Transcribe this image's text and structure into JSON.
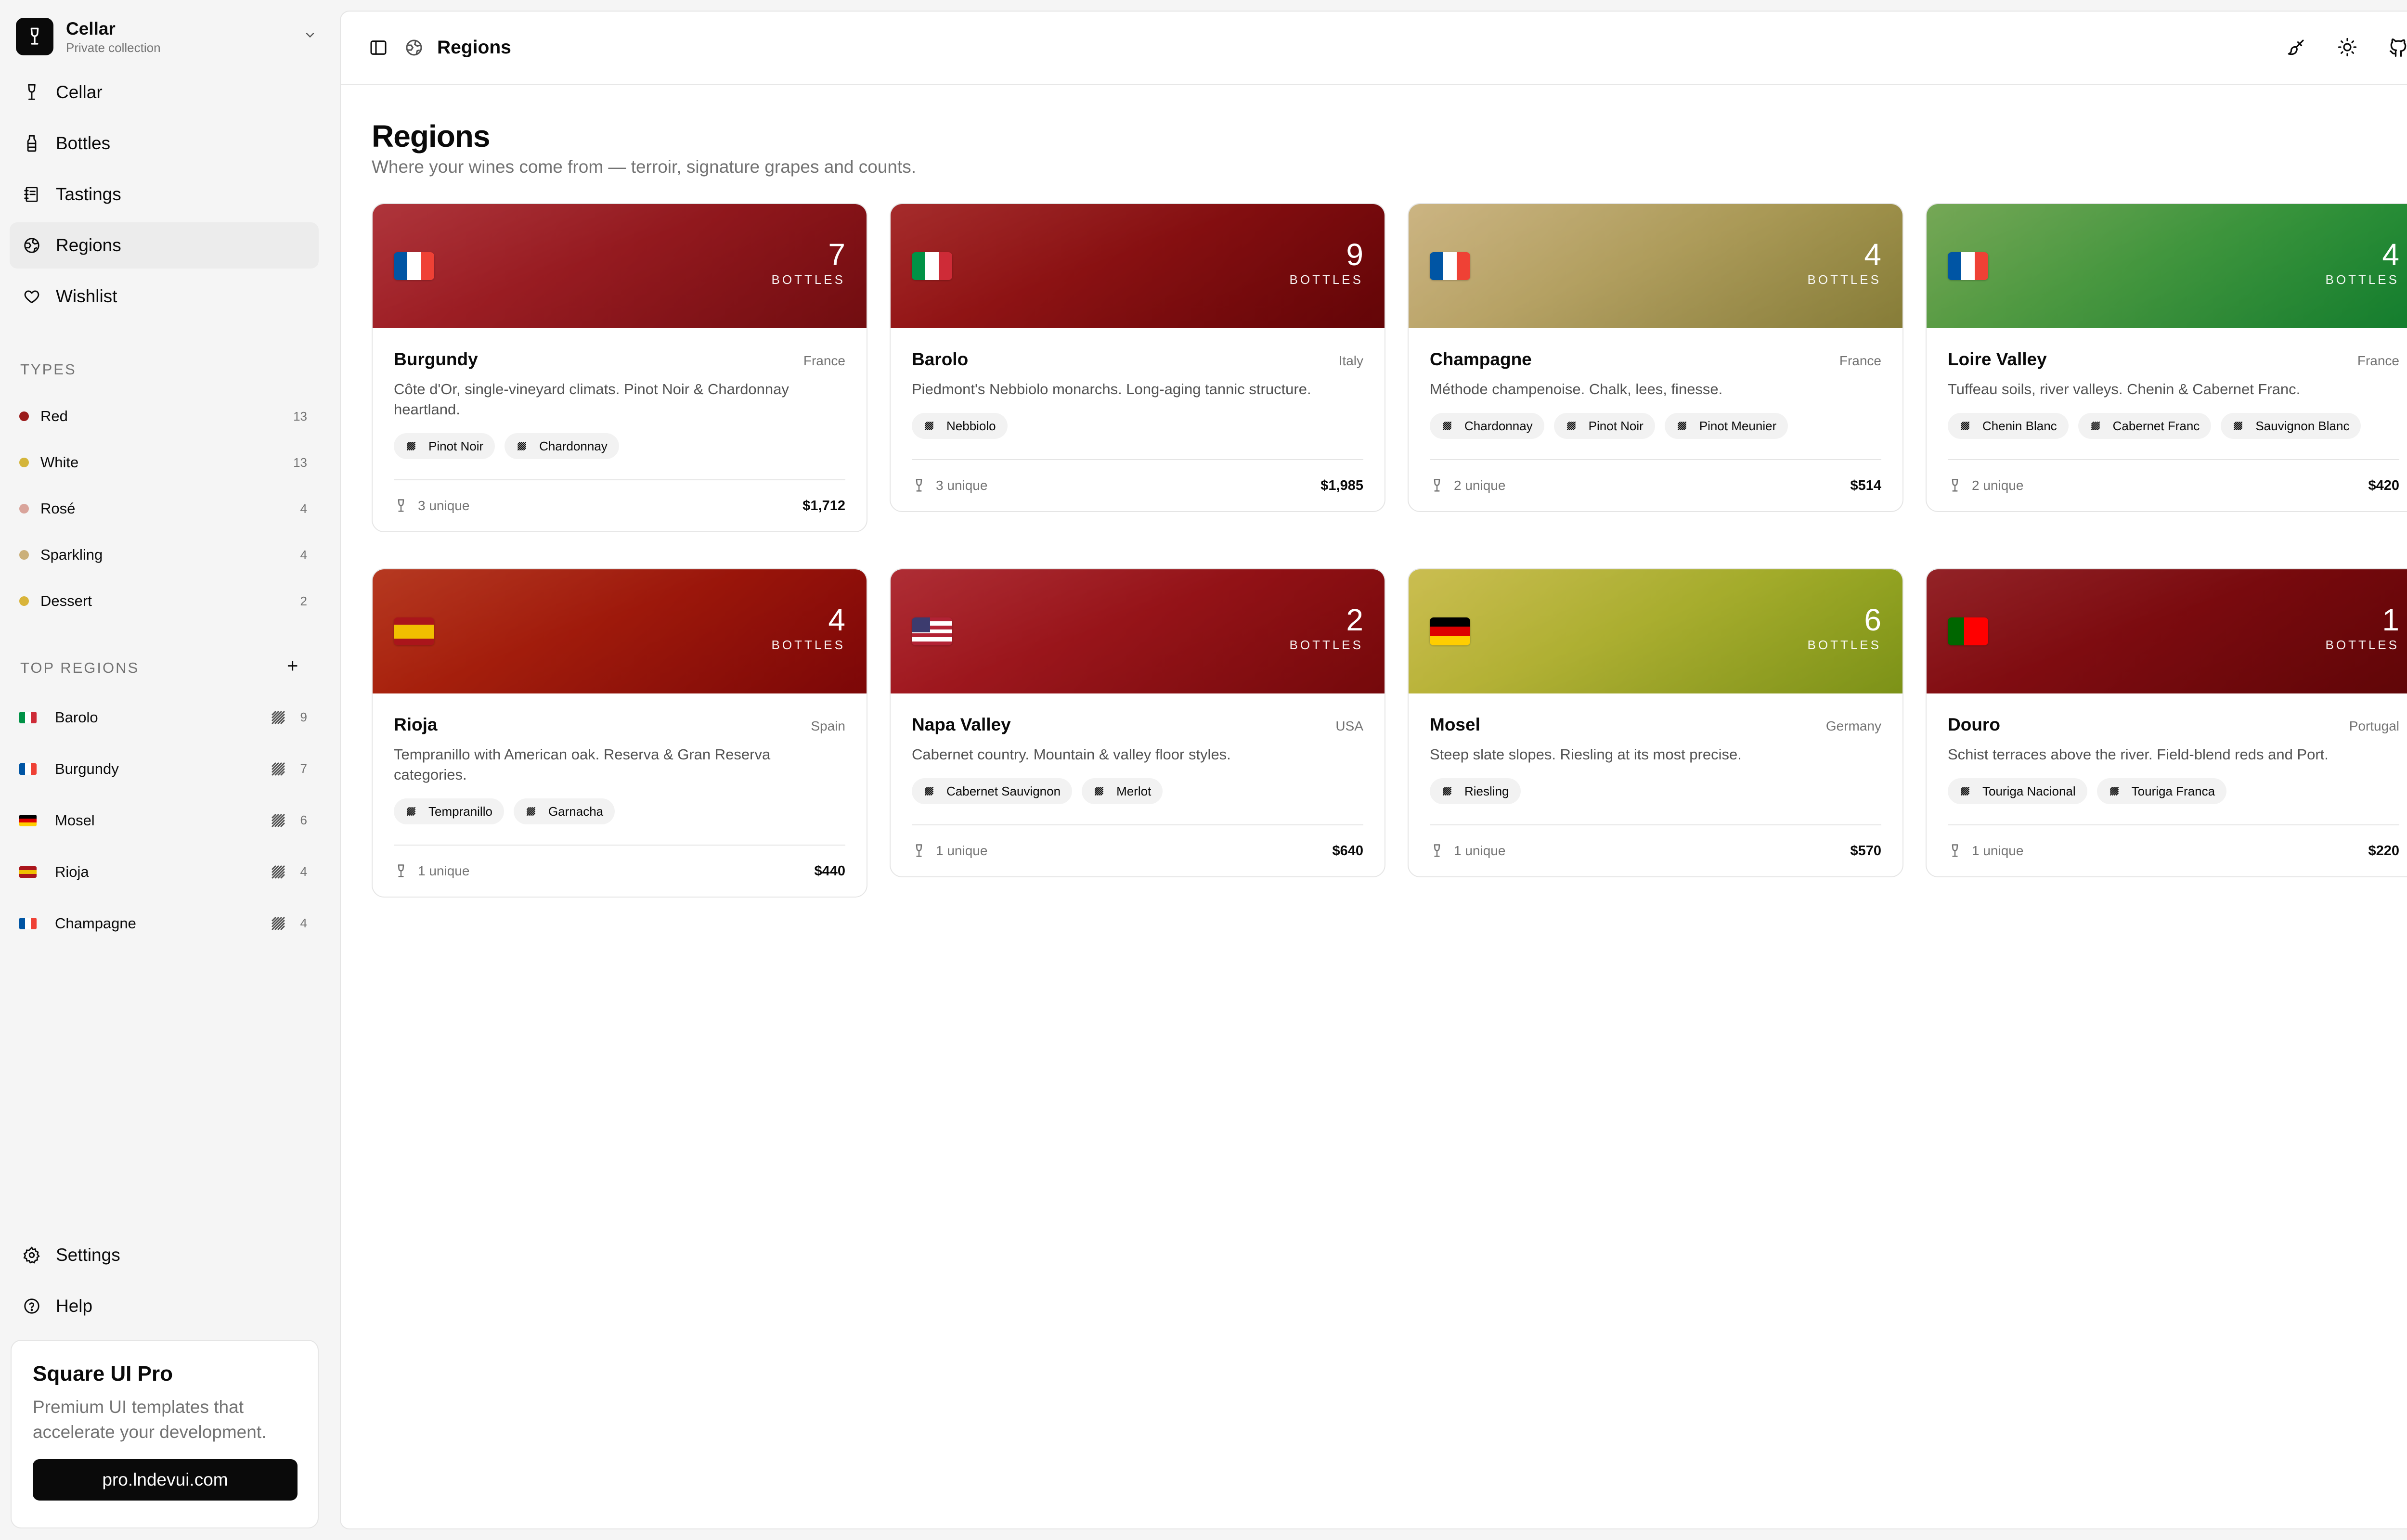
{
  "sidebar": {
    "brand": {
      "title": "Cellar",
      "subtitle": "Private collection"
    },
    "nav": [
      {
        "label": "Cellar",
        "icon": "wine-glass-icon",
        "active": false
      },
      {
        "label": "Bottles",
        "icon": "bottle-icon",
        "active": false
      },
      {
        "label": "Tastings",
        "icon": "notebook-icon",
        "active": false
      },
      {
        "label": "Regions",
        "icon": "globe-icon",
        "active": true
      },
      {
        "label": "Wishlist",
        "icon": "heart-icon",
        "active": false
      }
    ],
    "types_title": "TYPES",
    "types": [
      {
        "label": "Red",
        "count": "13",
        "color": "#9b1c1c"
      },
      {
        "label": "White",
        "count": "13",
        "color": "#d4b53a"
      },
      {
        "label": "Rosé",
        "count": "4",
        "color": "#d9a49b"
      },
      {
        "label": "Sparkling",
        "count": "4",
        "color": "#cbb07a"
      },
      {
        "label": "Dessert",
        "count": "2",
        "color": "#d9b43a"
      }
    ],
    "regions_title": "TOP REGIONS",
    "regions": [
      {
        "label": "Barolo",
        "count": "9",
        "flag": [
          "#009246",
          "#ffffff",
          "#ce2b37"
        ]
      },
      {
        "label": "Burgundy",
        "count": "7",
        "flag": [
          "#0055a4",
          "#ffffff",
          "#ef4135"
        ]
      },
      {
        "label": "Mosel",
        "count": "6",
        "flag": [
          "#000000",
          "#dd0000",
          "#ffce00"
        ]
      },
      {
        "label": "Rioja",
        "count": "4",
        "flag": [
          "#aa151b",
          "#f1bf00",
          "#aa151b"
        ]
      },
      {
        "label": "Champagne",
        "count": "4",
        "flag": [
          "#0055a4",
          "#ffffff",
          "#ef4135"
        ]
      }
    ],
    "bottom": [
      {
        "label": "Settings",
        "icon": "gear-icon"
      },
      {
        "label": "Help",
        "icon": "help-icon"
      }
    ],
    "promo": {
      "title": "Square UI Pro",
      "text": "Premium UI templates that accelerate your development.",
      "button": "pro.lndevui.com"
    }
  },
  "header": {
    "title": "Regions"
  },
  "page": {
    "title": "Regions",
    "subtitle": "Where your wines come from — terroir, signature grapes and counts."
  },
  "bottles_label": "BOTTLES",
  "cards": [
    {
      "name": "Burgundy",
      "country": "France",
      "bottles": "7",
      "desc": "Côte d'Or, single-vineyard climats. Pinot Noir & Chardonnay heartland.",
      "grapes": [
        "Pinot Noir",
        "Chardonnay"
      ],
      "unique": "3 unique",
      "value": "$1,712",
      "gradient": [
        "#a8242b",
        "#7e0e12"
      ],
      "flag": [
        "#0055a4",
        "#ffffff",
        "#ef4135"
      ]
    },
    {
      "name": "Barolo",
      "country": "Italy",
      "bottles": "9",
      "desc": "Piedmont's Nebbiolo monarchs. Long-aging tannic structure.",
      "grapes": [
        "Nebbiolo"
      ],
      "unique": "3 unique",
      "value": "$1,985",
      "gradient": [
        "#9e1a1a",
        "#6e0508"
      ],
      "flag": [
        "#009246",
        "#ffffff",
        "#ce2b37"
      ]
    },
    {
      "name": "Champagne",
      "country": "France",
      "bottles": "4",
      "desc": "Méthode champenoise. Chalk, lees, finesse.",
      "grapes": [
        "Chardonnay",
        "Pinot Noir",
        "Pinot Meunier"
      ],
      "unique": "2 unique",
      "value": "$514",
      "gradient": [
        "#c7ae78",
        "#958a3e"
      ],
      "flag": [
        "#0055a4",
        "#ffffff",
        "#ef4135"
      ]
    },
    {
      "name": "Loire Valley",
      "country": "France",
      "bottles": "4",
      "desc": "Tuffeau soils, river valleys. Chenin & Cabernet Franc.",
      "grapes": [
        "Chenin Blanc",
        "Cabernet Franc",
        "Sauvignon Blanc"
      ],
      "unique": "2 unique",
      "value": "$420",
      "gradient": [
        "#6aa048",
        "#148a32"
      ],
      "flag": [
        "#0055a4",
        "#ffffff",
        "#ef4135"
      ]
    },
    {
      "name": "Rioja",
      "country": "Spain",
      "bottles": "4",
      "desc": "Tempranillo with American oak. Reserva & Gran Reserva categories.",
      "grapes": [
        "Tempranillo",
        "Garnacha"
      ],
      "unique": "1 unique",
      "value": "$440",
      "gradient": [
        "#b0280e",
        "#8a0808"
      ],
      "flag": [
        "#aa151b",
        "#f1bf00",
        "#aa151b"
      ],
      "flag_h": true
    },
    {
      "name": "Napa Valley",
      "country": "USA",
      "bottles": "2",
      "desc": "Cabernet country. Mountain & valley floor styles.",
      "grapes": [
        "Cabernet Sauvignon",
        "Merlot"
      ],
      "unique": "1 unique",
      "value": "$640",
      "gradient": [
        "#a81c24",
        "#820a0c"
      ],
      "flag": [
        "#b22234",
        "#ffffff",
        "#b22234"
      ],
      "flag_h": true,
      "flag_canton": "#3c3b6e"
    },
    {
      "name": "Mosel",
      "country": "Germany",
      "bottles": "6",
      "desc": "Steep slate slopes. Riesling at its most precise.",
      "grapes": [
        "Riesling"
      ],
      "unique": "1 unique",
      "value": "$570",
      "gradient": [
        "#c6b842",
        "#8aa21a"
      ],
      "flag": [
        "#000000",
        "#dd0000",
        "#ffce00"
      ],
      "flag_h": true
    },
    {
      "name": "Douro",
      "country": "Portugal",
      "bottles": "1",
      "desc": "Schist terraces above the river. Field-blend reds and Port.",
      "grapes": [
        "Touriga Nacional",
        "Touriga Franca"
      ],
      "unique": "1 unique",
      "value": "$220",
      "gradient": [
        "#8a1015",
        "#6a0508"
      ],
      "flag": [
        "#006600",
        "#ff0000",
        "#ff0000"
      ],
      "flag_pt": true
    }
  ]
}
